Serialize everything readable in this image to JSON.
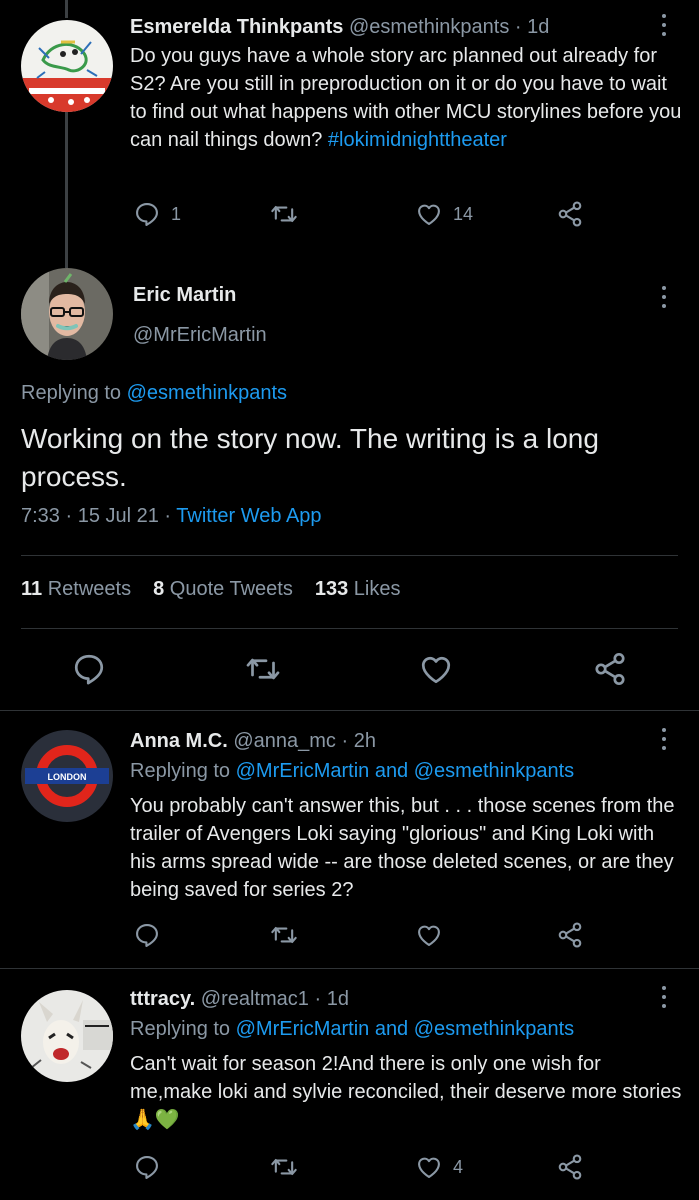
{
  "tweets": {
    "esme": {
      "name": "Esmerelda Thinkpants",
      "handle": "@esmethinkpants",
      "dot": "·",
      "time": "1d",
      "text": "Do you guys have a whole story arc planned out already for S2? Are you still in preproduction on it or do you have to wait to find out what happens with other MCU storylines before you can nail things down?",
      "hashtag": "#lokimidnighttheater",
      "replies": "1",
      "likes": "14"
    },
    "main": {
      "name": "Eric Martin",
      "handle": "@MrEricMartin",
      "replying_prefix": "Replying to",
      "replying_to": "@esmethinkpants",
      "text": "Working on the story now. The writing is a long process.",
      "time": "7:33 · 15 Jul 21 ·",
      "source": "Twitter Web App",
      "retweets_count": "11",
      "retweets_label": "Retweets",
      "quotes_count": "8",
      "quotes_label": "Quote Tweets",
      "likes_count": "133",
      "likes_label": "Likes"
    },
    "anna": {
      "name": "Anna M.C.",
      "handle": "@anna_mc",
      "dot": "·",
      "time": "2h",
      "replying_prefix": "Replying to",
      "replying_to": "@MrEricMartin and @esmethinkpants",
      "text": "You probably can't answer this, but . . . those scenes from the trailer of Avengers Loki saying \"glorious\" and King Loki with his arms spread wide -- are those deleted scenes, or are they being saved for series 2?",
      "avatar_text": "LONDON"
    },
    "tracy": {
      "name": "tttracy.",
      "handle": "@realtmac1",
      "dot": "·",
      "time": "1d",
      "replying_prefix": "Replying to",
      "replying_to": "@MrEricMartin and @esmethinkpants",
      "text": "Can't wait for season 2!And there is only one wish for me,make loki and sylvie reconciled, their deserve more stories🙏💚",
      "likes": "4"
    }
  },
  "colors": {
    "background": "#000000",
    "text": "#e7e9ea",
    "muted": "#8b98a5",
    "link": "#1d9bf0",
    "divider": "#2f3336"
  },
  "icons": [
    "reply-icon",
    "retweet-icon",
    "like-icon",
    "share-icon",
    "more-icon"
  ]
}
